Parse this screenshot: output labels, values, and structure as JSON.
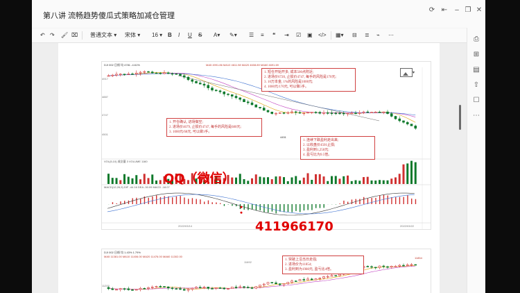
{
  "app": {
    "doc_title": "第八讲 流畅趋势傻瓜式策略加减仓管理",
    "window_controls": [
      "refresh-icon",
      "collapse-icon",
      "minimize-icon",
      "restore-icon",
      "close-icon"
    ]
  },
  "toolbar": {
    "style_select": "普通文本",
    "font_select": "宋体",
    "size_select": "16",
    "bold": "B",
    "italic": "I",
    "underline": "U",
    "strike": "S",
    "font_color": "A",
    "icons": [
      "undo-icon",
      "redo-icon",
      "format-painter-icon",
      "clear-format-icon",
      "highlight-icon",
      "unordered-list-icon",
      "ordered-list-icon",
      "quote-icon",
      "checkbox-icon",
      "image-icon",
      "code-icon",
      "table-icon",
      "divider-icon",
      "more-icon"
    ]
  },
  "right_sidebar": {
    "icons": [
      "export-icon",
      "insert-icon",
      "outline-icon",
      "share-icon",
      "bookmark-icon",
      "more-icon"
    ]
  },
  "chart1": {
    "header_l1": "DJI 002 日线 均 4781 -4.61%",
    "header_l2": "MA5 4991.86 MA10 4611.98 MA20 4608.89 MA60 4691.69",
    "annot_top": [
      "1. 短仓开始开多, 成本500点附近;",
      "2. 进场价6720, 止损价4747, 每手的风险是170元;",
      "3. 10万本金, 1%的风险是1000元;",
      "4. 1000元/170元, 可以做5手。"
    ],
    "annot_mid": [
      "1. 开仓确认, 进场做空;",
      "2. 进场价4679, 止损价4747, 每手的风险是680元;",
      "3. 1000元/68元, 可以做1手。"
    ],
    "annot_low": [
      "1. 连续下跌盈利走出来;",
      "2. 以收盘价4501止损;",
      "3. 盈利到1,250元;",
      "4. 盈亏比为9.5倍。"
    ],
    "price_labels": [
      "4917",
      "4887",
      "4747",
      "4501"
    ],
    "low_label": "4451",
    "vol_label": "VOL(5,10) 成交量 3 VOLUME 1160",
    "macd_label": "MACD(12,26,9) DIF -44.16 DEA -30.09 MACD -18.07",
    "date_left": "2022/03/14",
    "date_right": "2022/03/22"
  },
  "chart2": {
    "header_l1": "DJI 002 日线 均 1.43% 1.79%",
    "header_l2": "MA5 11381.00 MA10 11406.00 MA20 11476.00 MA60 11302.00",
    "annot": [
      "1. 突破上沿当日走强;",
      "2. 进场价为11854;",
      "3. 盈利到为1980元, 盈亏比4倍。"
    ],
    "price_labels": [
      "11854",
      "11692",
      "11200"
    ]
  },
  "watermark": {
    "qq": "QQ（微信）",
    "colon": "：",
    "number": "411966170"
  }
}
